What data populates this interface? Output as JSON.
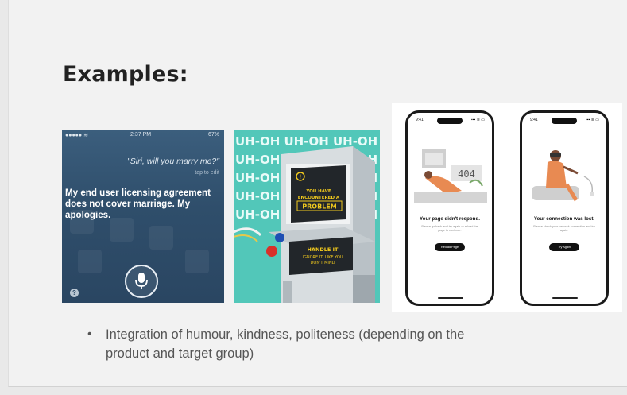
{
  "slide": {
    "title": "Examples:",
    "bullets": [
      {
        "text": "Integration of humour, kindness, politeness (depending on the product and target group)"
      }
    ]
  },
  "siri_example": {
    "status_carrier": "●●●●● ≋",
    "status_time": "2:37 PM",
    "status_battery": "67%",
    "question": "\"Siri, will you marry me?\"",
    "tap_to_edit": "tap to edit",
    "answer": "My end user licensing agreement does not cover marriage. My apologies.",
    "help_glyph": "?",
    "icons": [
      "microphone-icon",
      "help-icon"
    ]
  },
  "uhoh_example": {
    "background_text": [
      "UH-OH UH-OH UH-OH",
      "UH-OH UH-OH UH-OH",
      "UH-OH UH-OH UH-OH",
      "UH-OH UH-OH UH-OH",
      "UH-OH UH-OH UH-OH"
    ],
    "screen_text": [
      "YOU HAVE",
      "ENCOUNTERED A",
      "PROBLEM"
    ],
    "panel_text": [
      "HANDLE IT",
      "IGNORE IT. LIKE YOU",
      "DON'T MIND"
    ]
  },
  "phones_example": {
    "left_phone": {
      "time": "9:41",
      "status": "▪▪▪ ≋ ▭",
      "code": "404",
      "heading": "Your page didn't respond.",
      "sub": "Please go back and try again or reload the page to continue.",
      "button": "Reload Page"
    },
    "right_phone": {
      "time": "9:41",
      "status": "▪▪▪ ≋ ▭",
      "heading": "Your connection was lost.",
      "sub": "Please check your network connection and try again.",
      "button": "Try Again"
    }
  },
  "colors": {
    "background": "#f2f2f2",
    "siri_blue": "#2f4e6b",
    "uhoh_teal": "#52c7b9",
    "machine_screen": "#22262a",
    "warning_yellow": "#f1c91d",
    "illustration_orange": "#e88a52"
  }
}
